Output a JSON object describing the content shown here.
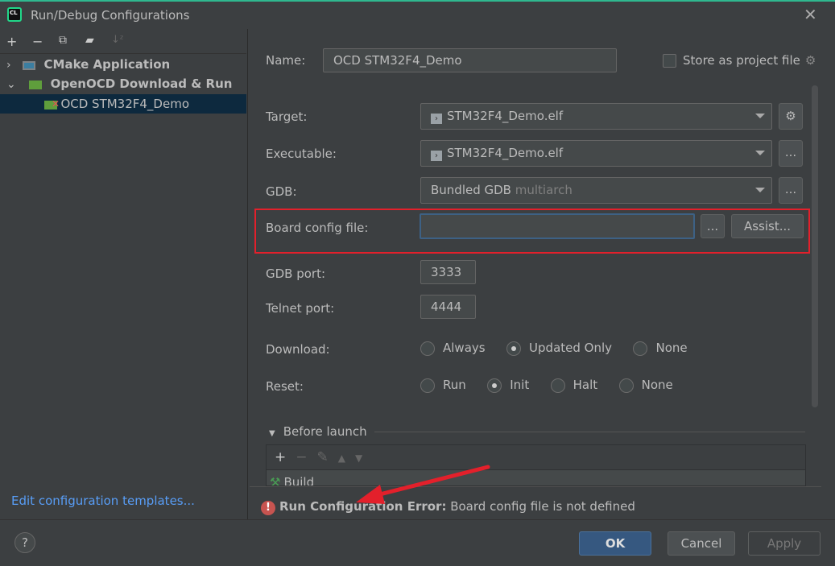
{
  "window": {
    "title": "Run/Debug Configurations",
    "logo_text": "CL"
  },
  "toolbar": {
    "icons": [
      "plus-icon",
      "minus-icon",
      "copy-icon",
      "new-folder-icon",
      "sort-az-icon"
    ]
  },
  "tree": [
    {
      "label": "CMake Application",
      "bold": true,
      "expanded": false
    },
    {
      "label": "OpenOCD Download & Run",
      "bold": true,
      "expanded": true
    },
    {
      "label": "OCD STM32F4_Demo",
      "selected": true
    }
  ],
  "edit_templates": "Edit configuration templates...",
  "form": {
    "name_label": "Name:",
    "name_value": "OCD STM32F4_Demo",
    "store_label": "Store as project file",
    "store_checked": false,
    "target_label": "Target:",
    "target_value": "STM32F4_Demo.elf",
    "executable_label": "Executable:",
    "executable_value": "STM32F4_Demo.elf",
    "gdb_label": "GDB:",
    "gdb_value": "Bundled GDB",
    "gdb_hint": "multiarch",
    "board_label": "Board config file:",
    "board_value": "",
    "browse": "...",
    "assist": "Assist...",
    "gdb_port_label": "GDB port:",
    "gdb_port": "3333",
    "telnet_label": "Telnet port:",
    "telnet_port": "4444",
    "download_label": "Download:",
    "download_options": [
      "Always",
      "Updated Only",
      "None"
    ],
    "download_selected": "Updated Only",
    "reset_label": "Reset:",
    "reset_options": [
      "Run",
      "Init",
      "Halt",
      "None"
    ],
    "reset_selected": "Init"
  },
  "before_launch": {
    "title": "Before launch",
    "items": [
      "Build"
    ]
  },
  "error": {
    "title": "Run Configuration Error:",
    "message": "Board config file is not defined"
  },
  "buttons": {
    "ok": "OK",
    "cancel": "Cancel",
    "apply": "Apply",
    "help": "?"
  },
  "colors": {
    "accent": "#365880",
    "highlight": "#e3202b",
    "link": "#589df6",
    "selection": "#0d293e"
  }
}
